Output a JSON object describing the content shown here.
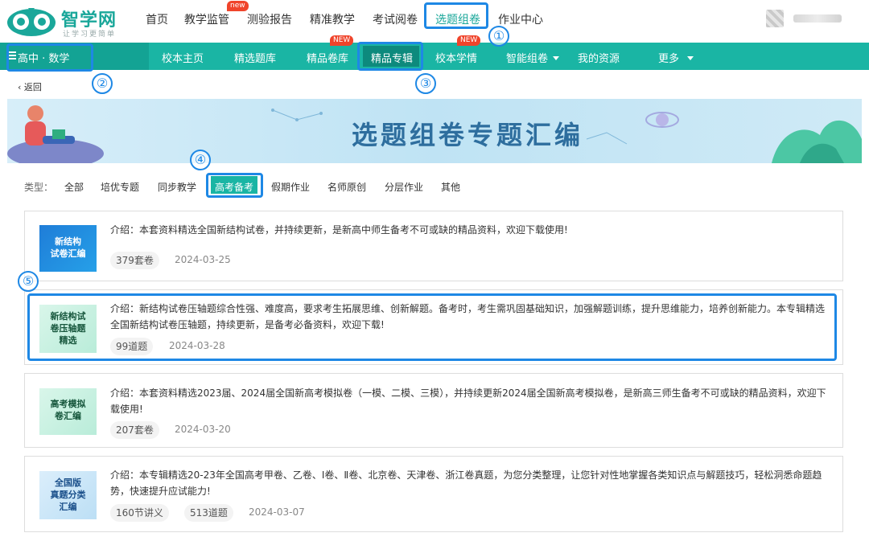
{
  "brand": {
    "name": "智学网",
    "slogan": "让学习更简单"
  },
  "top_nav": [
    {
      "label": "首页"
    },
    {
      "label": "教学监管",
      "badge": "new"
    },
    {
      "label": "测验报告"
    },
    {
      "label": "精准教学"
    },
    {
      "label": "考试阅卷"
    },
    {
      "label": "选题组卷",
      "active": true
    },
    {
      "label": "作业中心"
    }
  ],
  "stage": {
    "label": "高中 · 数学"
  },
  "green_nav": [
    {
      "label": "校本主页"
    },
    {
      "label": "精选题库"
    },
    {
      "label": "精品卷库",
      "badge": "NEW"
    },
    {
      "label": "精品专辑",
      "active": true
    },
    {
      "label": "校本学情",
      "badge": "NEW"
    },
    {
      "label": "智能组卷",
      "dropdown": true
    },
    {
      "label": "我的资源"
    },
    {
      "label": "更多",
      "dropdown": true
    }
  ],
  "back": {
    "label": "返回"
  },
  "banner": {
    "title": "选题组卷专题汇编"
  },
  "filter": {
    "label": "类型：",
    "items": [
      "全部",
      "培优专题",
      "同步教学",
      "高考备考",
      "假期作业",
      "名师原创",
      "分层作业",
      "其他"
    ],
    "active": "高考备考"
  },
  "callouts": [
    "①",
    "②",
    "③",
    "④",
    "⑤"
  ],
  "list": [
    {
      "thumb": "新结构\n试卷汇编",
      "desc": "介绍：本套资料精选全国新结构试卷，并持续更新，是新高中师生备考不可或缺的精品资料，欢迎下载使用!",
      "tags": [
        "379套卷"
      ],
      "date": "2024-03-25"
    },
    {
      "thumb": "新结构试\n卷压轴题\n精选",
      "desc": "介绍：新结构试卷压轴题综合性强、难度高，要求考生拓展思维、创新解题。备考时，考生需巩固基础知识，加强解题训练，提升思维能力，培养创新能力。本专辑精选全国新结构试卷压轴题，持续更新，是备考必备资料，欢迎下载!",
      "tags": [
        "99道题"
      ],
      "date": "2024-03-28"
    },
    {
      "thumb": "高考模拟\n卷汇编",
      "desc": "介绍：本套资料精选2023届、2024届全国新高考模拟卷（一模、二模、三模），并持续更新2024届全国新高考模拟卷，是新高三师生备考不可或缺的精品资料，欢迎下载使用!",
      "tags": [
        "207套卷"
      ],
      "date": "2024-03-20"
    },
    {
      "thumb": "全国版\n真题分类\n汇编",
      "desc": "介绍：本专辑精选20-23年全国高考甲卷、乙卷、Ⅰ卷、Ⅱ卷、北京卷、天津卷、浙江卷真题，为您分类整理，让您针对性地掌握各类知识点与解题技巧，轻松洞悉命题趋势，快速提升应试能力!",
      "tags": [
        "160节讲义",
        "513道题"
      ],
      "date": "2024-03-07"
    }
  ],
  "colors": {
    "accent": "#1ab5a4",
    "callout": "#1e88e5",
    "badge": "#f0442b"
  }
}
